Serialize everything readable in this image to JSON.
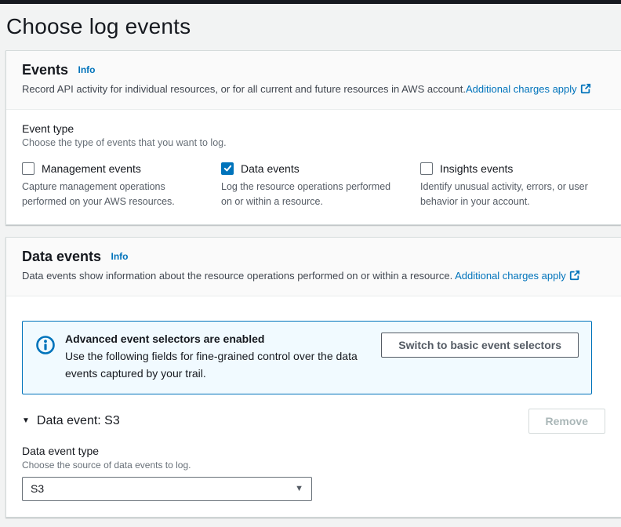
{
  "page": {
    "title": "Choose log events"
  },
  "events_card": {
    "title": "Events",
    "info_label": "Info",
    "description": "Record API activity for individual resources, or for all current and future resources in AWS account.",
    "charges_link_label": "Additional charges apply",
    "event_type": {
      "label": "Event type",
      "help": "Choose the type of events that you want to log.",
      "options": [
        {
          "label": "Management events",
          "description": "Capture management operations performed on your AWS resources.",
          "checked": false
        },
        {
          "label": "Data events",
          "description": "Log the resource operations performed on or within a resource.",
          "checked": true
        },
        {
          "label": "Insights events",
          "description": "Identify unusual activity, errors, or user behavior in your account.",
          "checked": false
        }
      ]
    }
  },
  "data_events_card": {
    "title": "Data events",
    "info_label": "Info",
    "description": "Data events show information about the resource operations performed on or within a resource. ",
    "charges_link_label": "Additional charges apply",
    "alert": {
      "title": "Advanced event selectors are enabled",
      "description": "Use the following fields for fine-grained control over the data events captured by your trail.",
      "button_label": "Switch to basic event selectors"
    },
    "data_event_section": {
      "title": "Data event: S3",
      "remove_label": "Remove",
      "field_label": "Data event type",
      "field_help": "Choose the source of data events to log.",
      "selected_value": "S3",
      "caret": "▼"
    }
  },
  "colors": {
    "accent_blue": "#0073bb",
    "alert_bg": "#f1faff",
    "dark_text": "#16191f",
    "secondary_text": "#545b64",
    "disabled_text": "#aab7b8"
  }
}
